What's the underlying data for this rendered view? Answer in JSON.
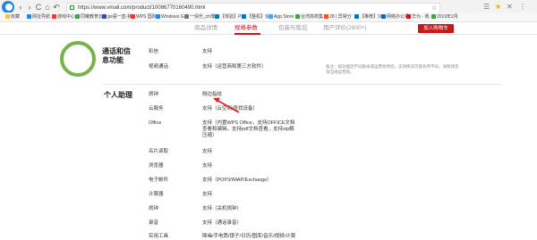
{
  "browser": {
    "url": "https://www.vmall.com/product/10086770160490.html",
    "nav": [
      "‹",
      "›",
      "C",
      "⌂",
      "↶",
      "☆"
    ],
    "tools": [
      "☰",
      "★",
      "✕",
      "⋮"
    ],
    "bookmarks": [
      {
        "label": "收藏",
        "color": "#f2c14e"
      },
      {
        "label": "网址导航",
        "color": "#1e88e5"
      },
      {
        "label": "游戏中心",
        "color": "#e53935"
      },
      {
        "label": "同曦教育云",
        "color": "#43a047"
      },
      {
        "label": "go语一直-我",
        "color": "#3949ab"
      },
      {
        "label": "WPS 国际",
        "color": "#e53935"
      },
      {
        "label": "Windows G",
        "color": "#1e88e5"
      },
      {
        "label": "一快乐_ch博",
        "color": "#777777"
      },
      {
        "label": "【体验】PS",
        "color": "#0277bd"
      },
      {
        "label": "【整机】论",
        "color": "#0277bd"
      },
      {
        "label": "App Store",
        "color": "#42a5f5"
      },
      {
        "label": "台湾高校集",
        "color": "#43a047"
      },
      {
        "label": "28 | 异常分",
        "color": "#f4511e"
      },
      {
        "label": "【推荐】16e",
        "color": "#0277bd"
      },
      {
        "label": "网络办公系",
        "color": "#1565c0"
      },
      {
        "label": "华为 · 我",
        "color": "#c8161d"
      },
      {
        "label": "2019年2月",
        "color": "#43a047"
      }
    ]
  },
  "tabs": [
    {
      "label": "商品详情",
      "active": false
    },
    {
      "label": "规格参数",
      "active": true
    },
    {
      "label": "包装与售后",
      "active": false
    },
    {
      "label": "用户评价(2600+)",
      "active": false
    }
  ],
  "cart_button": "加入购物车",
  "sections": {
    "comm_title": "通话和信息功能",
    "assistant_title": "个人助理"
  },
  "comm_rows": [
    {
      "label": "彩信",
      "value": "支持"
    },
    {
      "label": "视频通话",
      "value": "支持（运营商和第三方软件）"
    }
  ],
  "note": "备注：如功能因不同版本或运营商原因，支持情况可能有所不同，详情请咨询当地运营商。",
  "assistant_rows": [
    {
      "label": "闹钟",
      "value": "侧边指纹"
    },
    {
      "label": "云服务",
      "value": "支持（云空间/查找设备）"
    },
    {
      "label": "Office",
      "value": "支持（内置WPS Office，支持OFFICE文档查看和编辑，支持pdf文档查看，支持zip解压缩）"
    },
    {
      "label": "名片读取",
      "value": "支持"
    },
    {
      "label": "浏览器",
      "value": "支持"
    },
    {
      "label": "电子邮件",
      "value": "支持（POP3/IMAP/Exchange）"
    },
    {
      "label": "计算器",
      "value": "支持"
    },
    {
      "label": "闹钟",
      "value": "支持（关机闹钟）"
    },
    {
      "label": "录音",
      "value": "支持（通话录音）"
    },
    {
      "label": "实用工具",
      "value": "降噪/手电筒/镜子/日历/图库/音乐/视频/计算"
    }
  ],
  "colors": {
    "accent": "#c8161d",
    "ring": "#77b34a",
    "annotation_arrow": "#e02020"
  }
}
